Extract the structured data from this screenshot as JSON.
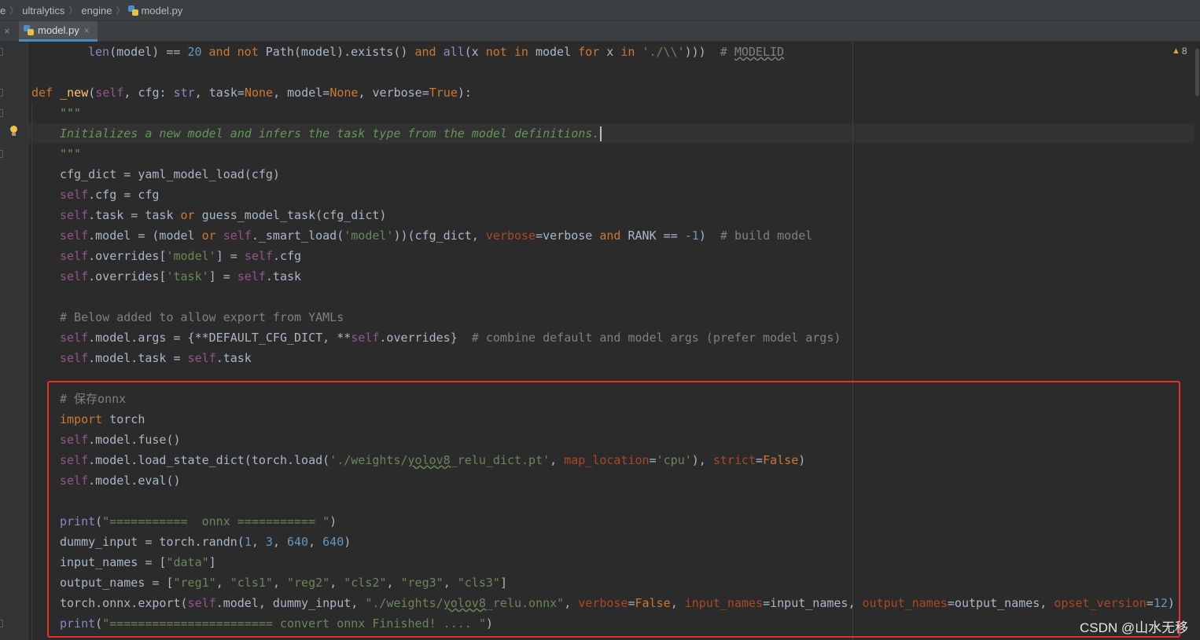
{
  "breadcrumb": {
    "items": [
      "e",
      "ultralytics",
      "engine",
      "model.py"
    ]
  },
  "tabs": {
    "close_glyph": "×",
    "active_tab_label": "model.py"
  },
  "inspection": {
    "warning_count": "8"
  },
  "icons": {
    "python_file": "python-file-icon",
    "warning": "warning-triangle-icon",
    "intention": "lightbulb-icon",
    "close": "close-icon"
  },
  "colors": {
    "keyword": "#cc7832",
    "function": "#ffc66d",
    "builtin": "#8888c6",
    "self": "#94558d",
    "string": "#6a8759",
    "number": "#6897bb",
    "comment": "#808080",
    "docstring": "#629755",
    "kwarg": "#aa4926",
    "highlight_box": "#e8302a",
    "active_tab_underline": "#4a88c7"
  },
  "code": {
    "lines": [
      {
        "t": [
          [
            "len",
            "bi"
          ],
          [
            "(model) == ",
            ""
          ],
          [
            "20",
            "nm"
          ],
          [
            " ",
            ""
          ],
          [
            "and",
            "kw"
          ],
          [
            " ",
            ""
          ],
          [
            "not",
            "kw"
          ],
          [
            " Path(model).exists() ",
            ""
          ],
          [
            "and",
            "kw"
          ],
          [
            " ",
            ""
          ],
          [
            "all",
            "bi"
          ],
          [
            "(x ",
            ""
          ],
          [
            "not",
            "kw"
          ],
          [
            " ",
            ""
          ],
          [
            "in",
            "kw"
          ],
          [
            " model ",
            ""
          ],
          [
            "for",
            "kw"
          ],
          [
            " x ",
            ""
          ],
          [
            "in",
            "kw"
          ],
          [
            " ",
            ""
          ],
          [
            "'./\\\\'",
            "st"
          ],
          [
            ")))  ",
            ""
          ],
          [
            "# ",
            "cm"
          ],
          [
            "MODELID",
            "cm ulg"
          ]
        ]
      },
      {
        "t": []
      },
      {
        "t": [
          [
            "def",
            "kw"
          ],
          [
            " ",
            ""
          ],
          [
            "_new",
            "fn"
          ],
          [
            "(",
            ""
          ],
          [
            "self",
            "sf"
          ],
          [
            ", cfg: ",
            ""
          ],
          [
            "str",
            "bi"
          ],
          [
            ", task=",
            ""
          ],
          [
            "None",
            "kw"
          ],
          [
            ", model=",
            ""
          ],
          [
            "None",
            "kw"
          ],
          [
            ", verbose=",
            ""
          ],
          [
            "True",
            "kw"
          ],
          [
            "):",
            ""
          ]
        ]
      },
      {
        "t": [
          [
            "\"\"\"",
            "doc"
          ]
        ]
      },
      {
        "t": [
          [
            "Initializes a new model and infers the task type from the model definitions.",
            "doc"
          ]
        ],
        "caret": true
      },
      {
        "t": [
          [
            "\"\"\"",
            "doc"
          ]
        ]
      },
      {
        "t": [
          [
            "cfg_dict = yaml_model_load(cfg)",
            ""
          ]
        ]
      },
      {
        "t": [
          [
            "self",
            "sf"
          ],
          [
            ".cfg = cfg",
            ""
          ]
        ]
      },
      {
        "t": [
          [
            "self",
            "sf"
          ],
          [
            ".task = task ",
            ""
          ],
          [
            "or",
            "kw"
          ],
          [
            " guess_model_task(cfg_dict)",
            ""
          ]
        ]
      },
      {
        "t": [
          [
            "self",
            "sf"
          ],
          [
            ".model = (model ",
            ""
          ],
          [
            "or",
            "kw"
          ],
          [
            " ",
            ""
          ],
          [
            "self",
            "sf"
          ],
          [
            "._smart_load(",
            ""
          ],
          [
            "'model'",
            "st"
          ],
          [
            "))(cfg_dict, ",
            ""
          ],
          [
            "verbose",
            "kwa"
          ],
          [
            "=verbose ",
            ""
          ],
          [
            "and",
            "kw"
          ],
          [
            " RANK == ",
            ""
          ],
          [
            "-1",
            "nm"
          ],
          [
            ")  ",
            ""
          ],
          [
            "# build model",
            "cm"
          ]
        ]
      },
      {
        "t": [
          [
            "self",
            "sf"
          ],
          [
            ".overrides[",
            ""
          ],
          [
            "'model'",
            "st"
          ],
          [
            "] = ",
            ""
          ],
          [
            "self",
            "sf"
          ],
          [
            ".cfg",
            ""
          ]
        ]
      },
      {
        "t": [
          [
            "self",
            "sf"
          ],
          [
            ".overrides[",
            ""
          ],
          [
            "'task'",
            "st"
          ],
          [
            "] = ",
            ""
          ],
          [
            "self",
            "sf"
          ],
          [
            ".task",
            ""
          ]
        ]
      },
      {
        "t": []
      },
      {
        "t": [
          [
            "# Below added to allow export from YAMLs",
            "cm"
          ]
        ]
      },
      {
        "t": [
          [
            "self",
            "sf"
          ],
          [
            ".model.args = {**DEFAULT_CFG_DICT, **",
            ""
          ],
          [
            "self",
            "sf"
          ],
          [
            ".overrides}  ",
            ""
          ],
          [
            "# combine default and model args (prefer model args)",
            "cm"
          ]
        ]
      },
      {
        "t": [
          [
            "self",
            "sf"
          ],
          [
            ".model.task = ",
            ""
          ],
          [
            "self",
            "sf"
          ],
          [
            ".task",
            ""
          ]
        ]
      },
      {
        "t": []
      },
      {
        "t": [
          [
            "# 保存onnx",
            "cm"
          ]
        ]
      },
      {
        "t": [
          [
            "import",
            "kw"
          ],
          [
            " torch",
            ""
          ]
        ]
      },
      {
        "t": [
          [
            "self",
            "sf"
          ],
          [
            ".model.fuse()",
            ""
          ]
        ]
      },
      {
        "t": [
          [
            "self",
            "sf"
          ],
          [
            ".model.load_state_dict(torch.load(",
            ""
          ],
          [
            "'./weights/",
            "st"
          ],
          [
            "yolov8",
            "st ul"
          ],
          [
            "_relu_dict.pt'",
            "st"
          ],
          [
            ", ",
            ""
          ],
          [
            "map_location",
            "kwa"
          ],
          [
            "=",
            ""
          ],
          [
            "'cpu'",
            "st"
          ],
          [
            "), ",
            ""
          ],
          [
            "strict",
            "kwa"
          ],
          [
            "=",
            ""
          ],
          [
            "False",
            "kw"
          ],
          [
            ")",
            ""
          ]
        ]
      },
      {
        "t": [
          [
            "self",
            "sf"
          ],
          [
            ".model.eval()",
            ""
          ]
        ]
      },
      {
        "t": []
      },
      {
        "t": [
          [
            "print",
            "bi"
          ],
          [
            "(",
            ""
          ],
          [
            "\"===========  onnx =========== \"",
            "st"
          ],
          [
            ")",
            ""
          ]
        ]
      },
      {
        "t": [
          [
            "dummy_input = torch.randn(",
            ""
          ],
          [
            "1",
            "nm"
          ],
          [
            ", ",
            ""
          ],
          [
            "3",
            "nm"
          ],
          [
            ", ",
            ""
          ],
          [
            "640",
            "nm"
          ],
          [
            ", ",
            ""
          ],
          [
            "640",
            "nm"
          ],
          [
            ")",
            ""
          ]
        ]
      },
      {
        "t": [
          [
            "input_names = [",
            ""
          ],
          [
            "\"data\"",
            "st"
          ],
          [
            "]",
            ""
          ]
        ]
      },
      {
        "t": [
          [
            "output_names = [",
            ""
          ],
          [
            "\"reg1\"",
            "st"
          ],
          [
            ", ",
            ""
          ],
          [
            "\"cls1\"",
            "st"
          ],
          [
            ", ",
            ""
          ],
          [
            "\"reg2\"",
            "st"
          ],
          [
            ", ",
            ""
          ],
          [
            "\"cls2\"",
            "st"
          ],
          [
            ", ",
            ""
          ],
          [
            "\"reg3\"",
            "st"
          ],
          [
            ", ",
            ""
          ],
          [
            "\"cls3\"",
            "st"
          ],
          [
            "]",
            ""
          ]
        ]
      },
      {
        "t": [
          [
            "torch.onnx.export(",
            ""
          ],
          [
            "self",
            "sf"
          ],
          [
            ".model, dummy_input, ",
            ""
          ],
          [
            "\"./weights/",
            "st"
          ],
          [
            "yolov8",
            "st ul"
          ],
          [
            "_relu.onnx\"",
            "st"
          ],
          [
            ", ",
            ""
          ],
          [
            "verbose",
            "kwa"
          ],
          [
            "=",
            ""
          ],
          [
            "False",
            "kw"
          ],
          [
            ", ",
            ""
          ],
          [
            "input_names",
            "kwa"
          ],
          [
            "=input_names, ",
            ""
          ],
          [
            "output_names",
            "kwa"
          ],
          [
            "=output_names, ",
            ""
          ],
          [
            "opset_version",
            "kwa"
          ],
          [
            "=",
            ""
          ],
          [
            "12",
            "nm"
          ],
          [
            ")",
            ""
          ]
        ]
      },
      {
        "t": [
          [
            "print",
            "bi"
          ],
          [
            "(",
            ""
          ],
          [
            "\"======================= convert onnx Finished! .... \"",
            "st"
          ],
          [
            ")",
            ""
          ]
        ]
      }
    ]
  },
  "watermark": "CSDN @山水无移"
}
